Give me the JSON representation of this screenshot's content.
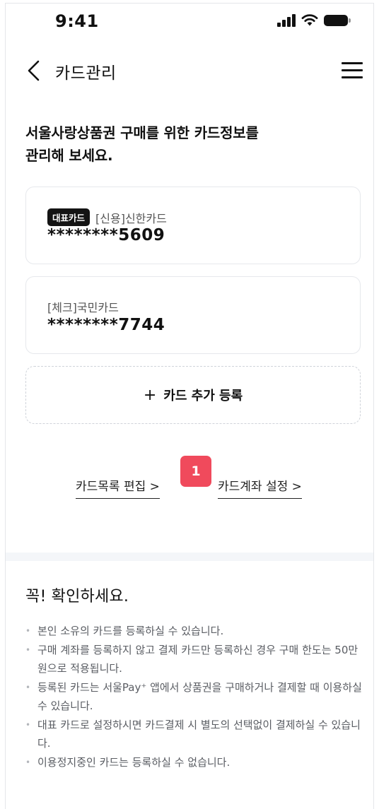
{
  "status_bar": {
    "time": "9:41"
  },
  "header": {
    "title": "카드관리"
  },
  "intro": {
    "line1": "서울사랑상품권 구매를 위한 카드정보를",
    "line2": "관리해 보세요."
  },
  "cards": [
    {
      "badge": "대표카드",
      "name": "[신용]신한카드",
      "number": "********5609"
    },
    {
      "badge": "",
      "name": "[체크]국민카드",
      "number": "********7744"
    }
  ],
  "add_card": {
    "plus": "+",
    "label": "카드 추가 등록"
  },
  "links": {
    "edit": "카드목록 편집 >",
    "account": "카드계좌 설정 >"
  },
  "step_badge": "1",
  "notice": {
    "title": "꼭! 확인하세요.",
    "items": [
      "본인 소유의 카드를 등록하실 수 있습니다.",
      "구매 계좌를 등록하지 않고 결제 카드만 등록하신 경우 구매 한도는 50만원으로 적용됩니다.",
      "등록된 카드는 서울Pay⁺ 앱에서 상품권을 구매하거나 결제할 때 이용하실 수 있습니다.",
      "대표 카드로 설정하시면 카드결제 시 별도의 선택없이 결제하실 수 있습니다.",
      "이용정지중인 카드는 등록하실 수 없습니다."
    ]
  },
  "colors": {
    "badge_red": "#f04a5c",
    "badge_dark": "#141414",
    "band": "#f4f6f9"
  }
}
